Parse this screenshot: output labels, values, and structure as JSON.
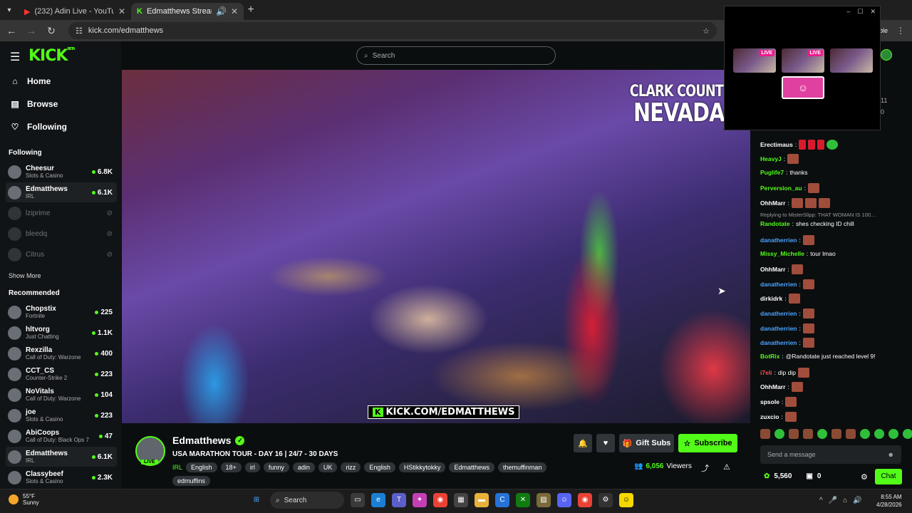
{
  "browser": {
    "tabs": [
      {
        "title": "(232) Adin Live - YouTube",
        "active": false
      },
      {
        "title": "Edmatthews Stream - Watc",
        "active": true
      }
    ],
    "url": "kick.com/edmatthews",
    "url_suffix": "ilable"
  },
  "topbar": {
    "logo": "KICK",
    "logo_badge": "BETA",
    "search_placeholder": "Search"
  },
  "nav": {
    "items": [
      {
        "label": "Home",
        "icon": "home-icon"
      },
      {
        "label": "Browse",
        "icon": "browse-icon"
      },
      {
        "label": "Following",
        "icon": "heart-icon"
      }
    ],
    "following_heading": "Following",
    "show_more": "Show More",
    "recommended_heading": "Recommended"
  },
  "following": [
    {
      "name": "Cheesur",
      "category": "Slots & Casino",
      "viewers": "6.8K",
      "live": true
    },
    {
      "name": "Edmatthews",
      "category": "IRL",
      "viewers": "6.1K",
      "live": true
    },
    {
      "name": "lziprime",
      "category": "",
      "viewers": "",
      "live": false
    },
    {
      "name": "bleedq",
      "category": "",
      "viewers": "",
      "live": false
    },
    {
      "name": "Citrus",
      "category": "",
      "viewers": "",
      "live": false
    }
  ],
  "recommended": [
    {
      "name": "Chopstix",
      "category": "Fortnite",
      "viewers": "225"
    },
    {
      "name": "hltvorg",
      "category": "Just Chatting",
      "viewers": "1.1K"
    },
    {
      "name": "Rexzilla",
      "category": "Call of Duty: Warzone",
      "viewers": "400"
    },
    {
      "name": "CCT_CS",
      "category": "Counter-Strike 2",
      "viewers": "223"
    },
    {
      "name": "NoVitals",
      "category": "Call of Duty: Warzone",
      "viewers": "104"
    },
    {
      "name": "joe",
      "category": "Slots & Casino",
      "viewers": "223"
    },
    {
      "name": "AbiCoops",
      "category": "Call of Duty: Black Ops 7",
      "viewers": "47"
    },
    {
      "name": "Edmatthews",
      "category": "IRL",
      "viewers": "6.1K"
    },
    {
      "name": "Classybeef",
      "category": "Slots & Casino",
      "viewers": "2.3K"
    }
  ],
  "video": {
    "overlay_line1": "CLARK COUNT",
    "overlay_line2": "NEVADA",
    "banner": "KICK.COM/EDMATTHEWS"
  },
  "stream": {
    "streamer": "Edmatthews",
    "live_badge": "LIVE",
    "title": "USA MARATHON TOUR - DAY 16 | 24/7 - 30 DAYS",
    "tags": [
      "IRL",
      "English",
      "18+",
      "irl",
      "funny",
      "adin",
      "UK",
      "rizz",
      "English",
      "HStikkytokky",
      "Edmatthews",
      "themuffinman",
      "edmuffins"
    ],
    "gift_subs": "Gift Subs",
    "subscribe": "Subscribe",
    "viewers": "6,056",
    "viewers_label": "Viewers"
  },
  "chat": {
    "messages": [
      {
        "user": "Erectimaus",
        "text": "",
        "color": "#ffffff",
        "emotes": 4
      },
      {
        "user": "HeavyJ",
        "text": "",
        "color": "#53fc18",
        "emotes": 1
      },
      {
        "user": "Puglife7",
        "text": "thanks",
        "color": "#53fc18",
        "emotes": 0
      },
      {
        "user": "Perversion_au",
        "text": "",
        "color": "#53fc18",
        "emotes": 1
      },
      {
        "user": "OhhMarr",
        "text": "",
        "color": "#ffffff",
        "emotes": 3
      },
      {
        "user": "Randotate",
        "text": "shes checking ID chill",
        "color": "#53fc18",
        "emotes": 0
      },
      {
        "user": "danatherrien",
        "text": "",
        "color": "#4aa3ff",
        "emotes": 1
      },
      {
        "user": "Missy_Michelle",
        "text": "tour lmao",
        "color": "#53fc18",
        "emotes": 0
      },
      {
        "user": "OhhMarr",
        "text": "",
        "color": "#ffffff",
        "emotes": 1
      },
      {
        "user": "danatherrien",
        "text": "",
        "color": "#4aa3ff",
        "emotes": 1
      },
      {
        "user": "dirkidrk",
        "text": "",
        "color": "#ffffff",
        "emotes": 1
      },
      {
        "user": "danatherrien",
        "text": "",
        "color": "#4aa3ff",
        "emotes": 1
      },
      {
        "user": "danatherrien",
        "text": "",
        "color": "#4aa3ff",
        "emotes": 1
      },
      {
        "user": "danatherrien",
        "text": "",
        "color": "#4aa3ff",
        "emotes": 1
      },
      {
        "user": "BotRix",
        "text": "@Randotate just reached level 9!",
        "color": "#53fc18",
        "emotes": 0
      },
      {
        "user": "i7eli",
        "text": "dip dip",
        "color": "#ff4d4d",
        "emotes": 1
      },
      {
        "user": "OhhMarr",
        "text": "",
        "color": "#ffffff",
        "emotes": 1
      },
      {
        "user": "spsole",
        "text": "",
        "color": "#ffffff",
        "emotes": 1
      },
      {
        "user": "zuxcio",
        "text": "",
        "color": "#ffffff",
        "emotes": 1
      }
    ],
    "reply_note": "Replying to MisterSlipp: THAT WOMAN IS 100...",
    "input_placeholder": "Send a message",
    "kicks": "5,560",
    "points": "0",
    "chat_button": "Chat"
  },
  "pip": {
    "live_label": "LIVE"
  },
  "taskbar": {
    "temp": "55°F",
    "weather": "Sunny",
    "search": "Search",
    "time": "8:55 AM",
    "date": "4/28/2026"
  }
}
